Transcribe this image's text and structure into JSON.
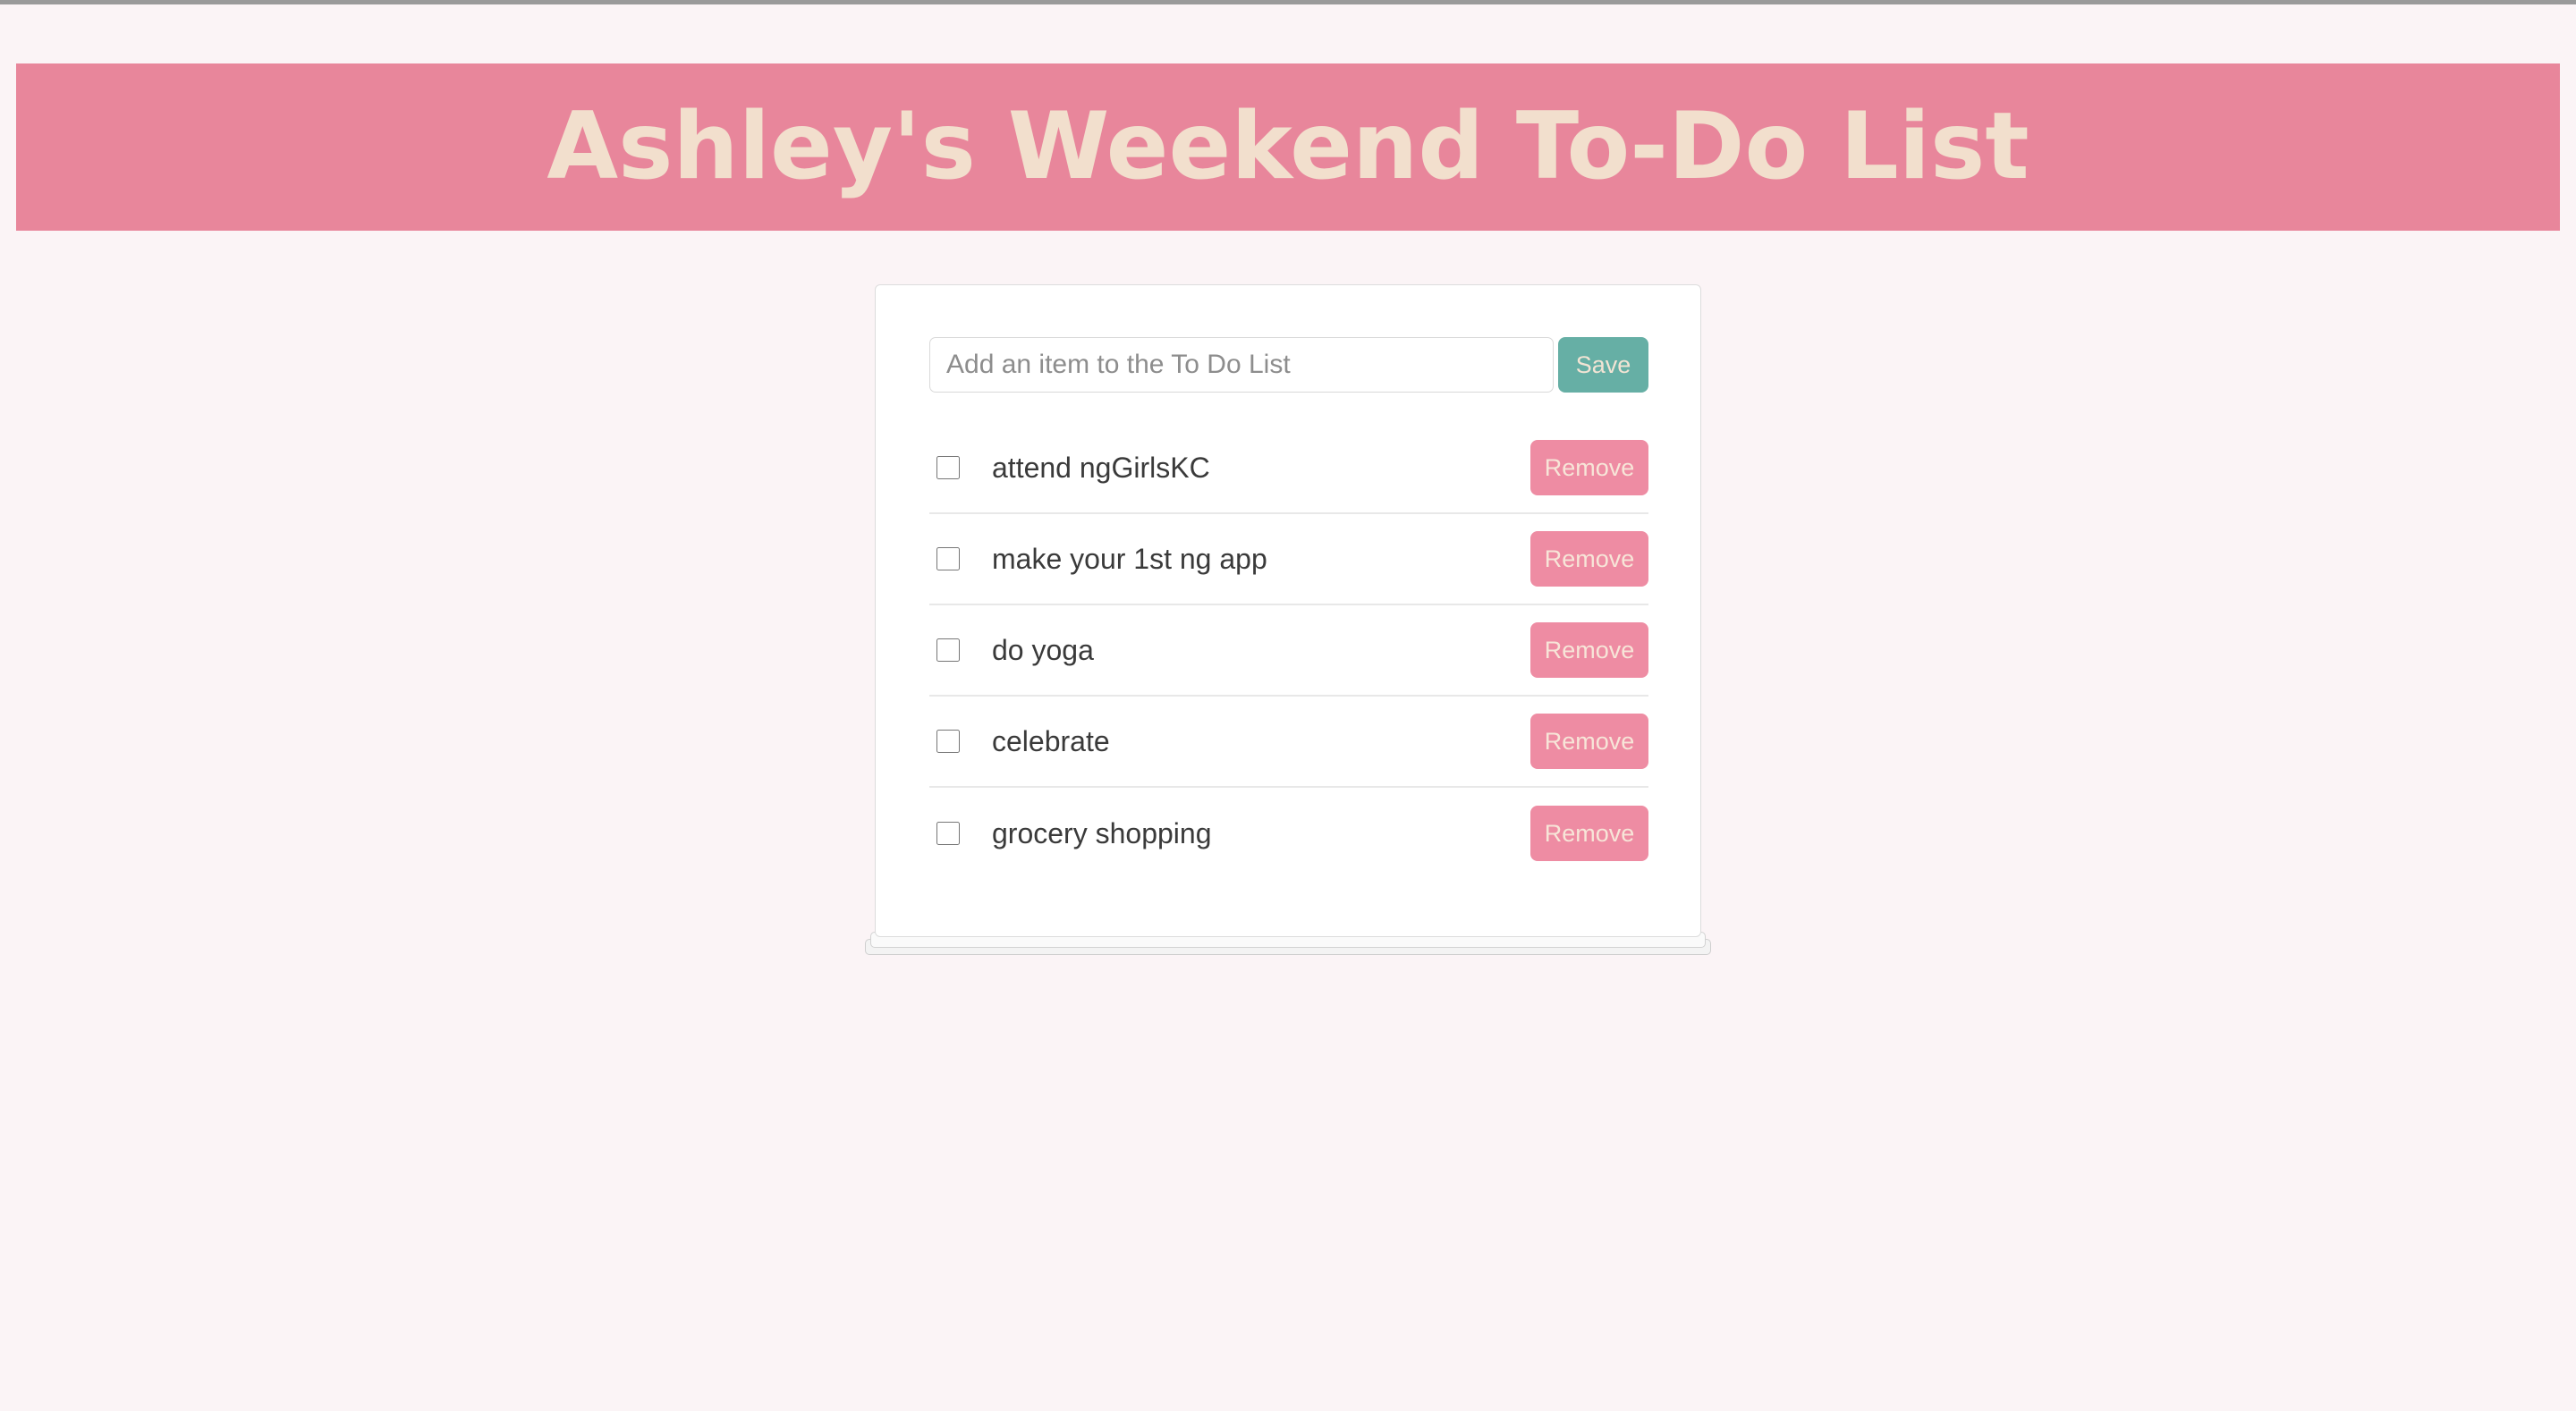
{
  "page": {
    "background_color": "#fbf4f6"
  },
  "header": {
    "title": "Ashley's Weekend To-Do List",
    "background_color": "#e8869b",
    "text_color": "#f2dfcd"
  },
  "add_form": {
    "input_value": "",
    "input_placeholder": "Add an item to the To Do List",
    "save_label": "Save",
    "save_color": "#66afa5"
  },
  "list": {
    "remove_label": "Remove",
    "remove_color": "#ee8ca3",
    "items": [
      {
        "label": "attend ngGirlsKC",
        "checked": false
      },
      {
        "label": "make your 1st ng app",
        "checked": false
      },
      {
        "label": "do yoga",
        "checked": false
      },
      {
        "label": "celebrate",
        "checked": false
      },
      {
        "label": "grocery shopping",
        "checked": false
      }
    ]
  }
}
